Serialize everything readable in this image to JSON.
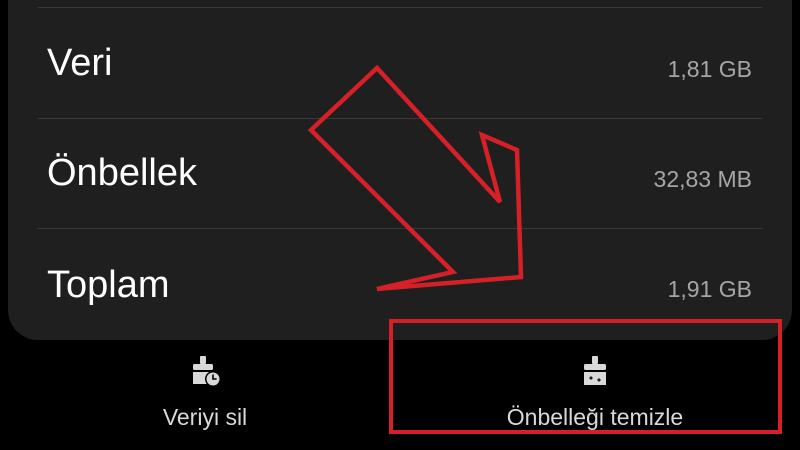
{
  "storage": {
    "rows": [
      {
        "label": "Veri",
        "value": "1,81 GB"
      },
      {
        "label": "Önbellek",
        "value": "32,83 MB"
      },
      {
        "label": "Toplam",
        "value": "1,91 GB"
      }
    ]
  },
  "actions": {
    "clear_data_label": "Veriyi sil",
    "clear_cache_label": "Önbelleği temizle",
    "clear_data_icon": "broom-clock-icon",
    "clear_cache_icon": "broom-icon"
  },
  "annotation": {
    "color": "#d42026",
    "arrow_icon": "arrow-down-right-icon"
  }
}
